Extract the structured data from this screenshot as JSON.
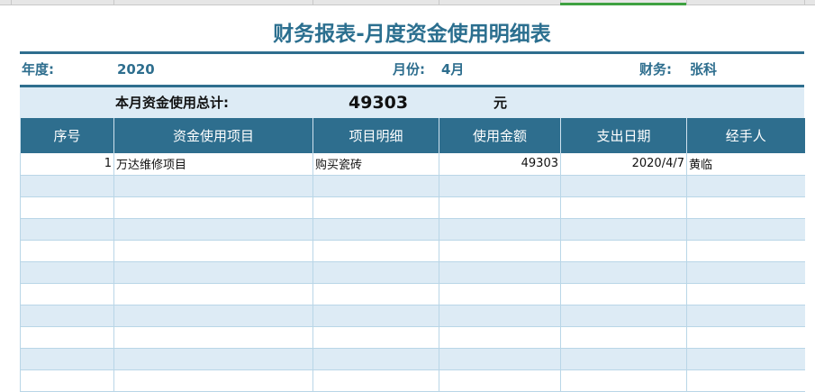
{
  "title": "财务报表-月度资金使用明细表",
  "info": {
    "year_label": "年度:",
    "year": "2020",
    "month_label": "月份:",
    "month": "4月",
    "finance_label": "财务:",
    "finance": "张科"
  },
  "total": {
    "label": "本月资金使用总计:",
    "value": "49303",
    "unit": "元"
  },
  "table": {
    "headers": [
      "序号",
      "资金使用项目",
      "项目明细",
      "使用金额",
      "支出日期",
      "经手人"
    ],
    "rows": [
      [
        "1",
        "万达维修项目",
        "购买瓷砖",
        "49303",
        "2020/4/7",
        "黄临"
      ]
    ],
    "empty_rows": 10
  },
  "colors": {
    "accent": "#2e6e8e",
    "stripe": "#ddebf5"
  }
}
